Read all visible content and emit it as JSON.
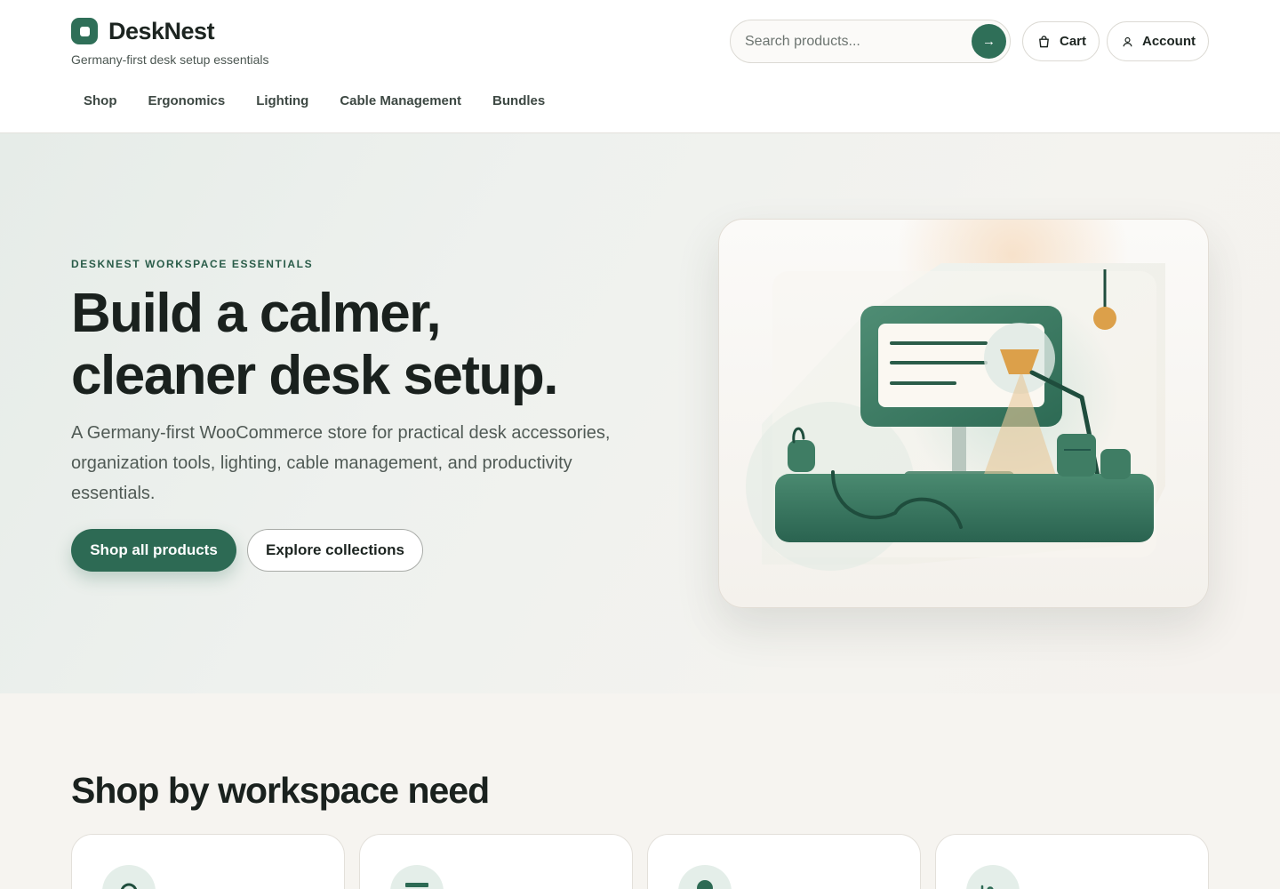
{
  "brand": {
    "name": "DeskNest",
    "tagline": "Germany-first desk setup essentials"
  },
  "search": {
    "placeholder": "Search products...",
    "submit_icon": "arrow-right-icon"
  },
  "header_actions": {
    "cart_label": "Cart",
    "account_label": "Account"
  },
  "nav": {
    "items": [
      "Shop",
      "Ergonomics",
      "Lighting",
      "Cable Management",
      "Bundles"
    ]
  },
  "hero": {
    "eyebrow": "DESKNEST WORKSPACE ESSENTIALS",
    "title_line1": "Build a calmer,",
    "title_line2": "cleaner desk setup.",
    "description": "A Germany-first WooCommerce store for practical desk accessories, organization tools, lighting, cable management, and productivity essentials.",
    "primary_cta": "Shop all products",
    "secondary_cta": "Explore collections"
  },
  "categories": {
    "title": "Shop by workspace need",
    "icons": [
      "search-icon",
      "organizer-icon",
      "lamp-icon",
      "cable-icon"
    ]
  },
  "colors": {
    "accent": "#2d6a54",
    "accent_light": "#e4eee9",
    "lamp": "#dca04a",
    "background": "#f6f4f0"
  }
}
